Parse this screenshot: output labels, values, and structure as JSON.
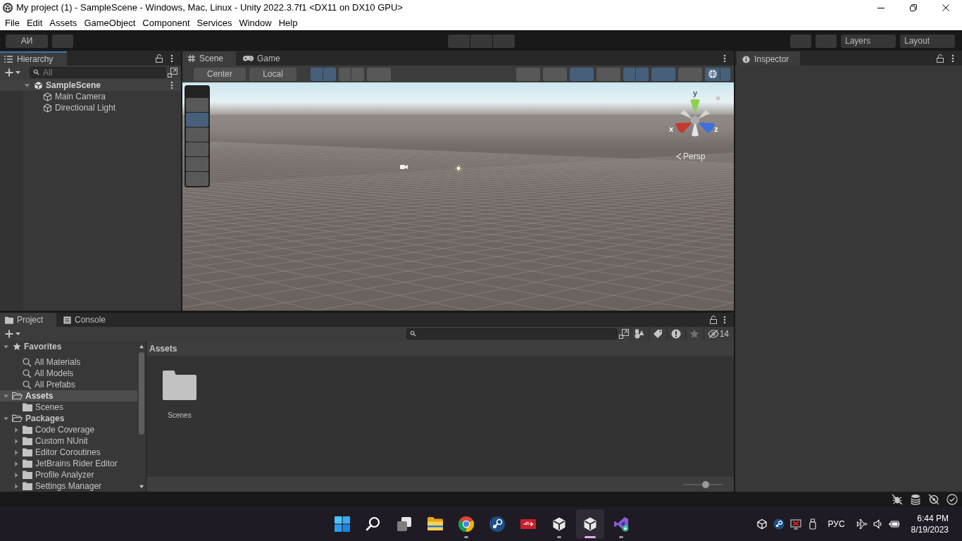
{
  "window": {
    "title": "My project (1) - SampleScene - Windows, Mac, Linux - Unity 2022.3.7f1 <DX11 on DX10 GPU>"
  },
  "menu": [
    "File",
    "Edit",
    "Assets",
    "GameObject",
    "Component",
    "Services",
    "Window",
    "Help"
  ],
  "toolbar": {
    "account": "АИ",
    "layers": "Layers",
    "layout": "Layout"
  },
  "hierarchy": {
    "tab": {
      "label": "Hierarchy",
      "focused": true
    },
    "search": {
      "placeholder": "All"
    },
    "scene": {
      "label": "SampleScene",
      "expanded": true,
      "children": [
        {
          "label": "Main Camera"
        },
        {
          "label": "Directional Light"
        }
      ]
    }
  },
  "scene_view": {
    "tabs": [
      {
        "label": "Scene",
        "kind": "scene",
        "selected": true
      },
      {
        "label": "Game",
        "kind": "game",
        "selected": false
      }
    ],
    "pivot_buttons": [
      "Center",
      "Local"
    ],
    "left_toggles": [
      {
        "kind": "split",
        "on": true
      },
      {
        "kind": "split",
        "on": false
      },
      {
        "kind": "single",
        "on": false
      }
    ],
    "right_toggles": [
      {
        "kind": "single",
        "on": false
      },
      {
        "kind": "single",
        "on": false
      },
      {
        "kind": "single",
        "on": true
      },
      {
        "kind": "single",
        "on": false
      },
      {
        "kind": "split",
        "on": true
      },
      {
        "kind": "single",
        "on": true
      },
      {
        "kind": "single",
        "on": false
      },
      {
        "kind": "gizmo",
        "on": true
      }
    ],
    "tools": [
      {
        "selected": false
      },
      {
        "selected": true
      },
      {
        "selected": false
      },
      {
        "selected": false
      },
      {
        "selected": false
      },
      {
        "selected": false
      }
    ],
    "axis_labels": [
      "y",
      "x",
      "z"
    ],
    "projection": "Persp"
  },
  "inspector": {
    "tab": {
      "label": "Inspector",
      "focused": false
    }
  },
  "project": {
    "tabs": [
      {
        "label": "Project",
        "kind": "project",
        "selected": true
      },
      {
        "label": "Console",
        "kind": "console",
        "selected": false
      }
    ],
    "hidden_count": "14",
    "tree": [
      {
        "label": "Favorites",
        "kind": "favorites",
        "expanded": true,
        "selected": false,
        "children": [
          {
            "label": "All Materials",
            "kind": "search",
            "selected": false
          },
          {
            "label": "All Models",
            "kind": "search",
            "selected": false
          },
          {
            "label": "All Prefabs",
            "kind": "search",
            "selected": false
          }
        ]
      },
      {
        "label": "Assets",
        "kind": "folder",
        "expanded": true,
        "selected": true,
        "children": [
          {
            "label": "Scenes",
            "kind": "folder",
            "selected": false
          }
        ]
      },
      {
        "label": "Packages",
        "kind": "folder",
        "expanded": true,
        "selected": false,
        "children": [
          {
            "label": "Code Coverage",
            "kind": "folder",
            "expanded": false,
            "selected": false
          },
          {
            "label": "Custom NUnit",
            "kind": "folder",
            "expanded": false,
            "selected": false
          },
          {
            "label": "Editor Coroutines",
            "kind": "folder",
            "expanded": false,
            "selected": false
          },
          {
            "label": "JetBrains Rider Editor",
            "kind": "folder",
            "expanded": false,
            "selected": false
          },
          {
            "label": "Profile Analyzer",
            "kind": "folder",
            "expanded": false,
            "selected": false
          },
          {
            "label": "Settings Manager",
            "kind": "folder",
            "expanded": false,
            "selected": false
          }
        ]
      }
    ],
    "breadcrumb": "Assets",
    "items": [
      {
        "label": "Scenes",
        "kind": "folder"
      }
    ],
    "zoom_slider": {
      "level": 0.58
    }
  },
  "taskbar": {
    "apps": [
      {
        "kind": "start",
        "running": false,
        "active": false
      },
      {
        "kind": "search",
        "running": false,
        "active": false
      },
      {
        "kind": "task_view",
        "running": false,
        "active": false
      },
      {
        "kind": "folder",
        "running": false,
        "active": false
      },
      {
        "kind": "browser",
        "running": true,
        "active": false
      },
      {
        "kind": "steam",
        "running": false,
        "active": false
      },
      {
        "kind": "usb",
        "running": false,
        "active": false
      },
      {
        "kind": "unity",
        "running": true,
        "active": false
      },
      {
        "kind": "unity",
        "running": true,
        "active": true
      },
      {
        "kind": "ide",
        "running": true,
        "active": false
      }
    ],
    "language": "РУС",
    "time": "6:44 PM",
    "date": "8/19/2023"
  }
}
